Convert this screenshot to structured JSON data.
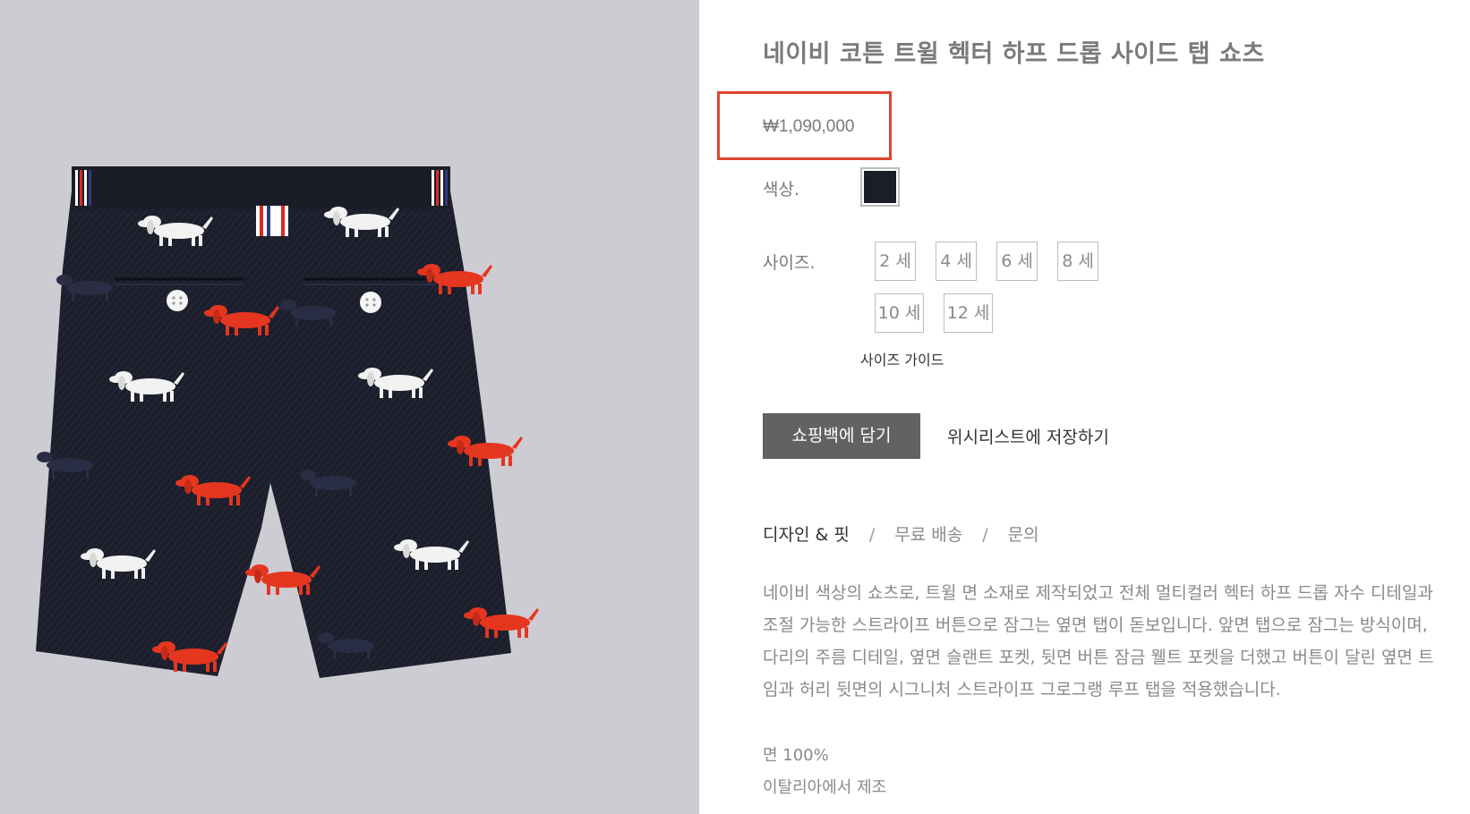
{
  "product": {
    "title": "네이비 코튼 트윌 헥터 하프 드롭 사이드 탭 쇼츠",
    "price": "₩1,090,000",
    "color_label": "색상.",
    "color_swatch": "#1c1e26",
    "size_label": "사이즈.",
    "sizes": [
      "2 세",
      "4 세",
      "6 세",
      "8 세",
      "10 세",
      "12 세"
    ],
    "size_guide": "사이즈 가이드",
    "add_to_bag": "쇼핑백에 담기",
    "wishlist": "위시리스트에 저장하기"
  },
  "tabs": [
    {
      "label": "디자인 & 핏",
      "active": true
    },
    {
      "label": "무료 배송",
      "active": false
    },
    {
      "label": "문의",
      "active": false
    }
  ],
  "tab_separator": "/",
  "description": "네이비 색상의 쇼츠로, 트윌 면 소재로 제작되었고 전체 멀티컬러 헥터 하프 드롭 자수 디테일과 조절 가능한 스트라이프 버튼으로 잠그는 옆면 탭이 돋보입니다. 앞면 탭으로 잠그는 방식이며, 다리의 주름 디테일, 옆면 슬랜트 포켓, 뒷면 버튼 잠금 웰트 포켓을 더했고 버튼이 달린 옆면 트임과 허리 뒷면의 시그니처 스트라이프 그로그랭 루프 탭을 적용했습니다.",
  "composition": "면 100%",
  "origin": "이탈리아에서 제조",
  "colors": {
    "image_bg": "#cdccd2",
    "highlight": "#e0432d",
    "button_bg": "#626262"
  }
}
